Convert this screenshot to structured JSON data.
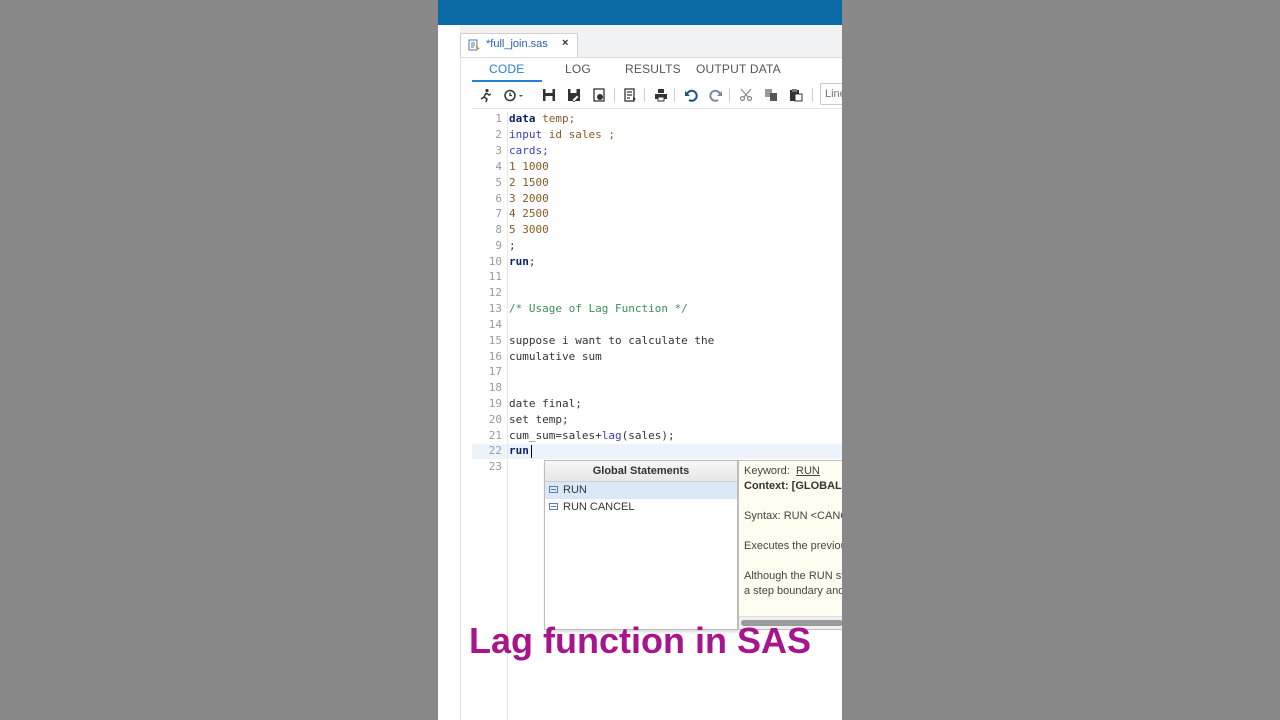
{
  "tab": {
    "filename": "*full_join.sas",
    "close": "×"
  },
  "subtabs": [
    "CODE",
    "LOG",
    "RESULTS",
    "OUTPUT DATA"
  ],
  "toolbar": {
    "icons": [
      "run-icon",
      "history-icon",
      "save-icon",
      "save-as-icon",
      "save-program-icon",
      "format-icon",
      "print-icon",
      "undo-icon",
      "redo-icon",
      "cut-icon",
      "copy-icon",
      "paste-icon"
    ],
    "line_placeholder": "Line #"
  },
  "code_lines": [
    {
      "n": "1"
    },
    {
      "n": "2"
    },
    {
      "n": "3"
    },
    {
      "n": "4"
    },
    {
      "n": "5"
    },
    {
      "n": "6"
    },
    {
      "n": "7"
    },
    {
      "n": "8"
    },
    {
      "n": "9"
    },
    {
      "n": "10"
    },
    {
      "n": "11"
    },
    {
      "n": "12"
    },
    {
      "n": "13"
    },
    {
      "n": "14"
    },
    {
      "n": "15"
    },
    {
      "n": "16"
    },
    {
      "n": "17"
    },
    {
      "n": "18"
    },
    {
      "n": "19"
    },
    {
      "n": "20"
    },
    {
      "n": "21"
    },
    {
      "n": "22"
    },
    {
      "n": "23"
    }
  ],
  "code": {
    "l1_kw": "data",
    "l1_rest": " temp;",
    "l2_kw": "input",
    "l2_rest": " id sales ;",
    "l3": "cards;",
    "l4": "1 1000",
    "l5": "2 1500",
    "l6": "3 2000",
    "l7": "4 2500",
    "l8": "5 3000",
    "l9": ";",
    "l10_kw": "run",
    "l10_rest": ";",
    "l13": "/* Usage of Lag Function */",
    "l15": "suppose i want to calculate the",
    "l16": "cumulative sum",
    "l19": "date final;",
    "l20": "set temp;",
    "l21_a": "cum_sum=sales+",
    "l21_fn": "lag",
    "l21_b": "(sales);",
    "l22": "run"
  },
  "autocomplete": {
    "header": "Global Statements",
    "items": [
      "RUN",
      "RUN CANCEL"
    ]
  },
  "help": {
    "keyword_label": "Keyword:",
    "keyword": "RUN",
    "context": "Context: [GLOBAL STATEM",
    "syntax": "Syntax: RUN <CANCEL>;",
    "desc1": "Executes the previously en",
    "desc2": "Although the RUN stateme",
    "desc3": "a step boundary and can n"
  },
  "overlay": {
    "title": "Lag function in SAS"
  },
  "colors": {
    "topbar": "#0b6aa6",
    "accent": "#2a7fd4",
    "overlay_title": "#a6158c"
  }
}
